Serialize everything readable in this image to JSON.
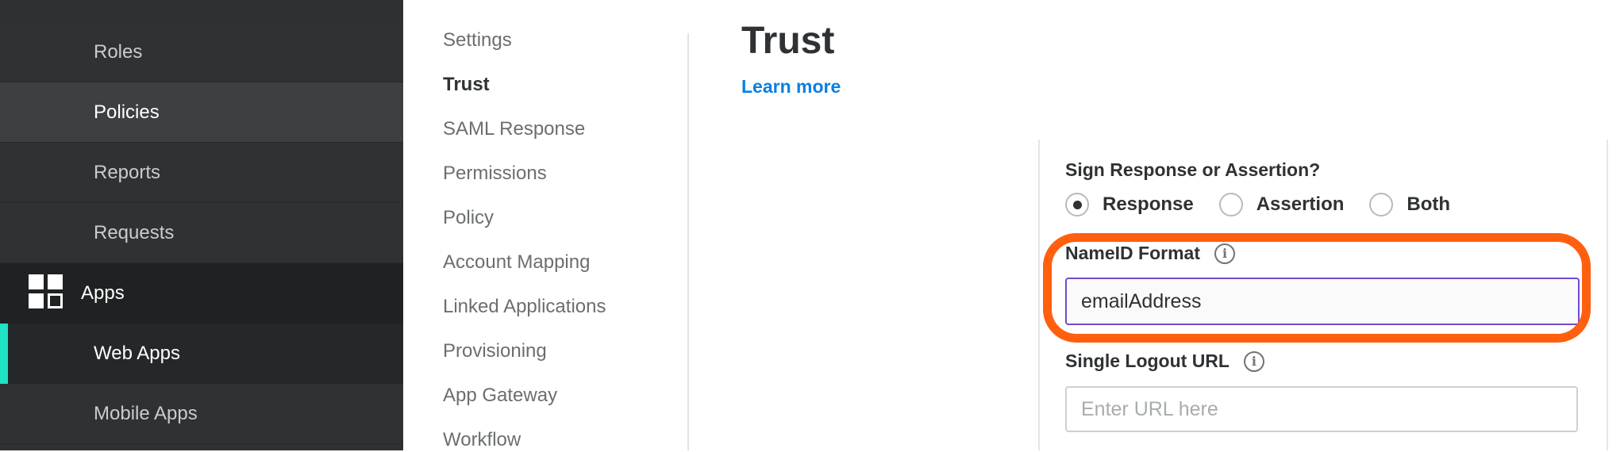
{
  "sidebar": {
    "items": [
      {
        "label": "Roles"
      },
      {
        "label": "Policies"
      },
      {
        "label": "Reports"
      },
      {
        "label": "Requests"
      },
      {
        "label": "Apps",
        "icon": "apps-grid-icon"
      },
      {
        "label": "Web Apps"
      },
      {
        "label": "Mobile Apps"
      }
    ]
  },
  "subnav": {
    "items": [
      {
        "label": "Settings"
      },
      {
        "label": "Trust"
      },
      {
        "label": "SAML Response"
      },
      {
        "label": "Permissions"
      },
      {
        "label": "Policy"
      },
      {
        "label": "Account Mapping"
      },
      {
        "label": "Linked Applications"
      },
      {
        "label": "Provisioning"
      },
      {
        "label": "App Gateway"
      },
      {
        "label": "Workflow"
      }
    ],
    "current": "Trust"
  },
  "main": {
    "title": "Trust",
    "learn_more": "Learn more",
    "sign": {
      "label": "Sign Response or Assertion?",
      "options": [
        {
          "label": "Response",
          "checked": true
        },
        {
          "label": "Assertion",
          "checked": false
        },
        {
          "label": "Both",
          "checked": false
        }
      ]
    },
    "nameid": {
      "label": "NameID Format",
      "value": "emailAddress"
    },
    "logout": {
      "label": "Single Logout URL",
      "placeholder": "Enter URL here"
    }
  },
  "colors": {
    "sidebar_bg": "#2e3133",
    "active_accent": "#1ee3c4",
    "link": "#0b7fe0",
    "focus_border": "#6f4ccd",
    "highlight_ring": "#ff5f0f"
  }
}
